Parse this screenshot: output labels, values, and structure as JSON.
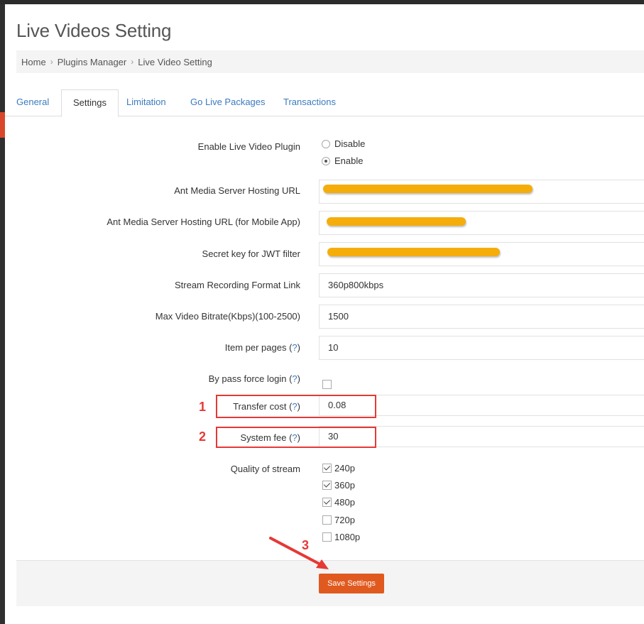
{
  "page": {
    "title": "Live Videos Setting"
  },
  "breadcrumb": [
    "Home",
    "Plugins Manager",
    "Live Video Setting"
  ],
  "tabs": [
    "General",
    "Settings",
    "Limitation",
    "Go Live Packages",
    "Transactions"
  ],
  "active_tab": "Settings",
  "form": {
    "enable_plugin": {
      "label": "Enable Live Video Plugin",
      "options": [
        "Disable",
        "Enable"
      ],
      "selected": "Enable"
    },
    "hosting_url": {
      "label": "Ant Media Server Hosting URL"
    },
    "hosting_url_mobile": {
      "label": "Ant Media Server Hosting URL (for Mobile App)"
    },
    "secret_key": {
      "label": "Secret key for JWT filter"
    },
    "recording_format": {
      "label": "Stream Recording Format Link",
      "value": "360p800kbps"
    },
    "max_bitrate": {
      "label": "Max Video Bitrate(Kbps)(100-2500)",
      "value": "1500"
    },
    "items_per_page": {
      "label": "Item per pages",
      "help": "?",
      "value": "10"
    },
    "bypass_force_login": {
      "label": "By pass force login",
      "help": "?",
      "checked": false
    },
    "transfer_cost": {
      "label": "Transfer cost",
      "help": "?",
      "value": "0.08"
    },
    "system_fee": {
      "label": "System fee",
      "help": "?",
      "value": "30"
    },
    "quality": {
      "label": "Quality of stream",
      "options": [
        {
          "label": "240p",
          "checked": true
        },
        {
          "label": "360p",
          "checked": true
        },
        {
          "label": "480p",
          "checked": true
        },
        {
          "label": "720p",
          "checked": false
        },
        {
          "label": "1080p",
          "checked": false
        }
      ]
    }
  },
  "save_button": "Save Settings",
  "annotations": {
    "one": "1",
    "two": "2",
    "three": "3",
    "color": "#e53935"
  },
  "colors": {
    "accent": "#e05a1f",
    "link": "#3a7bbf",
    "redaction": "#f5ad0c"
  }
}
